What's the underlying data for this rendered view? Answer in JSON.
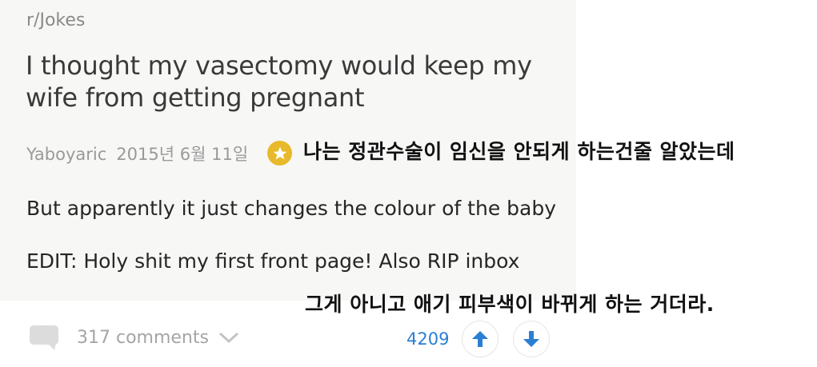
{
  "post": {
    "subreddit": "r/Jokes",
    "title": "I thought my vasectomy would keep my wife from getting pregnant",
    "author": "Yaboyaric",
    "date": "2015년 6월 11일",
    "body_line1": "But apparently it just changes the colour of the baby",
    "body_line2": "EDIT: Holy shit my first front page! Also RIP inbox"
  },
  "translation": {
    "line1": "나는 정관수술이 임신을 안되게 하는건줄 알았는데",
    "line2": "그게 아니고 애기 피부색이 바뀌게 하는 거더라."
  },
  "footer": {
    "comments": "317 comments",
    "score": "4209"
  },
  "colors": {
    "gold_award": "#e8b92a",
    "vote_blue": "#2a7fd4"
  },
  "icons": [
    "comment-bubble-icon",
    "chevron-down-icon",
    "star-icon",
    "arrow-up-icon",
    "arrow-down-icon"
  ]
}
